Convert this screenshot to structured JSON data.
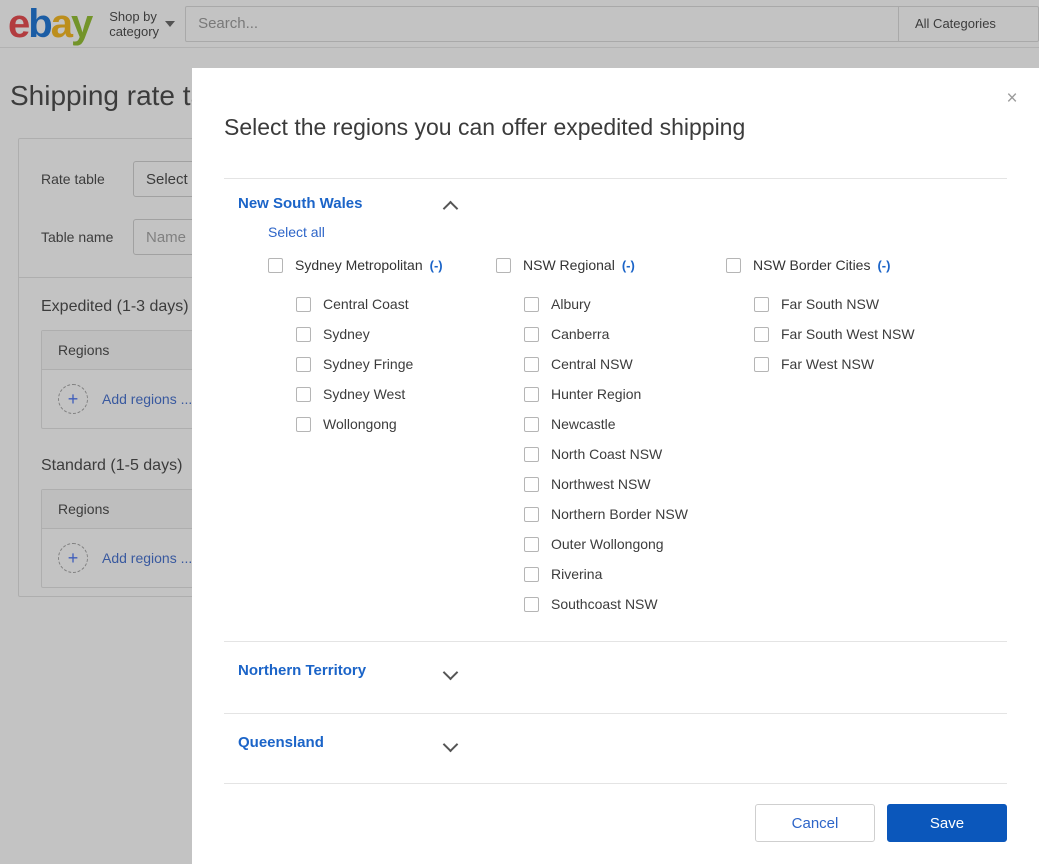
{
  "header": {
    "logo": {
      "e": "e",
      "b": "b",
      "a": "a",
      "y": "y"
    },
    "shop_by_line1": "Shop by",
    "shop_by_line2": "category",
    "search_placeholder": "Search...",
    "search_value": "",
    "all_categories": "All Categories"
  },
  "page": {
    "title": "Shipping rate table",
    "rate_table_label": "Rate table",
    "rate_table_value": "Select",
    "table_name_label": "Table name",
    "table_name_placeholder": "Name",
    "services": [
      {
        "title": "Expedited (1-3 days)",
        "column_header": "Regions",
        "add_label": "Add regions ..."
      },
      {
        "title": "Standard (1-5 days)",
        "column_header": "Regions",
        "add_label": "Add regions ..."
      }
    ]
  },
  "modal": {
    "title": "Select the regions you can offer expedited shipping",
    "close_icon": "×",
    "select_all_label": "Select all",
    "minus_label": "(-)",
    "cancel_label": "Cancel",
    "save_label": "Save",
    "accent_color": "#0b57bb",
    "link_color": "#1b64c8",
    "states": [
      {
        "name": "New South Wales",
        "expanded": true,
        "chevron": "chevron-up",
        "groups": [
          {
            "name": "Sydney Metropolitan",
            "children": [
              "Central Coast",
              "Sydney",
              "Sydney Fringe",
              "Sydney West",
              "Wollongong"
            ]
          },
          {
            "name": "NSW Regional",
            "children": [
              "Albury",
              "Canberra",
              "Central NSW",
              "Hunter Region",
              "Newcastle",
              "North Coast NSW",
              "Northwest NSW",
              "Northern Border NSW",
              "Outer Wollongong",
              "Riverina",
              "Southcoast NSW"
            ]
          },
          {
            "name": "NSW Border Cities",
            "children": [
              "Far South NSW",
              "Far South West NSW",
              "Far West NSW"
            ]
          }
        ]
      },
      {
        "name": "Northern Territory",
        "expanded": false,
        "chevron": "chevron-down",
        "groups": []
      },
      {
        "name": "Queensland",
        "expanded": false,
        "chevron": "chevron-down",
        "groups": []
      }
    ]
  }
}
